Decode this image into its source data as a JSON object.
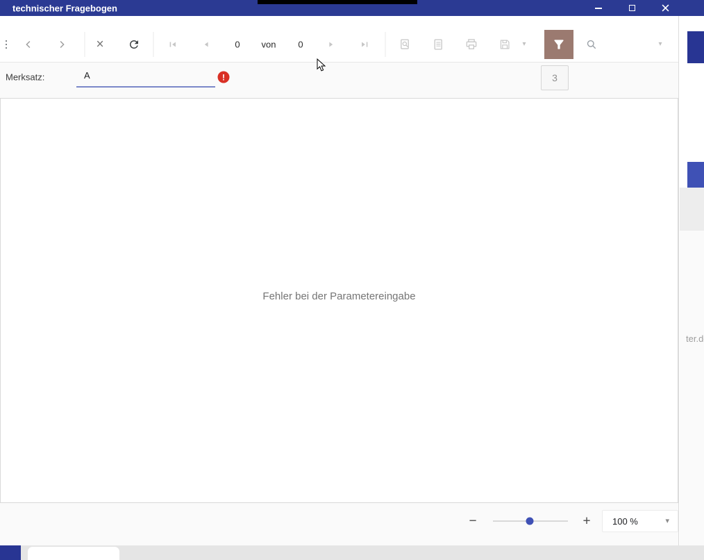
{
  "titlebar": {
    "title": "technischer Fragebogen"
  },
  "toolbar": {
    "current_page": "0",
    "pages_separator": "von",
    "total_pages": "0"
  },
  "parameters": {
    "label": "Merksatz:",
    "value": "A",
    "error_glyph": "!",
    "counter": "3"
  },
  "viewer": {
    "message": "Fehler bei der Parametereingabe"
  },
  "zoombar": {
    "zoom_out": "−",
    "zoom_in": "+",
    "zoom_level": "100 %"
  },
  "background": {
    "url_fragment": "ter.de"
  },
  "icons": {
    "kebab": "⋮",
    "close_x": "×",
    "caret_down": "▾"
  },
  "colors": {
    "titlebar_bg": "#2b3a93",
    "accent_blue": "#3f51b5",
    "filter_active_bg": "#9b7a70",
    "error_red": "#d93025",
    "input_underline": "#7b88c9",
    "bg_block_dark": "#283593"
  }
}
